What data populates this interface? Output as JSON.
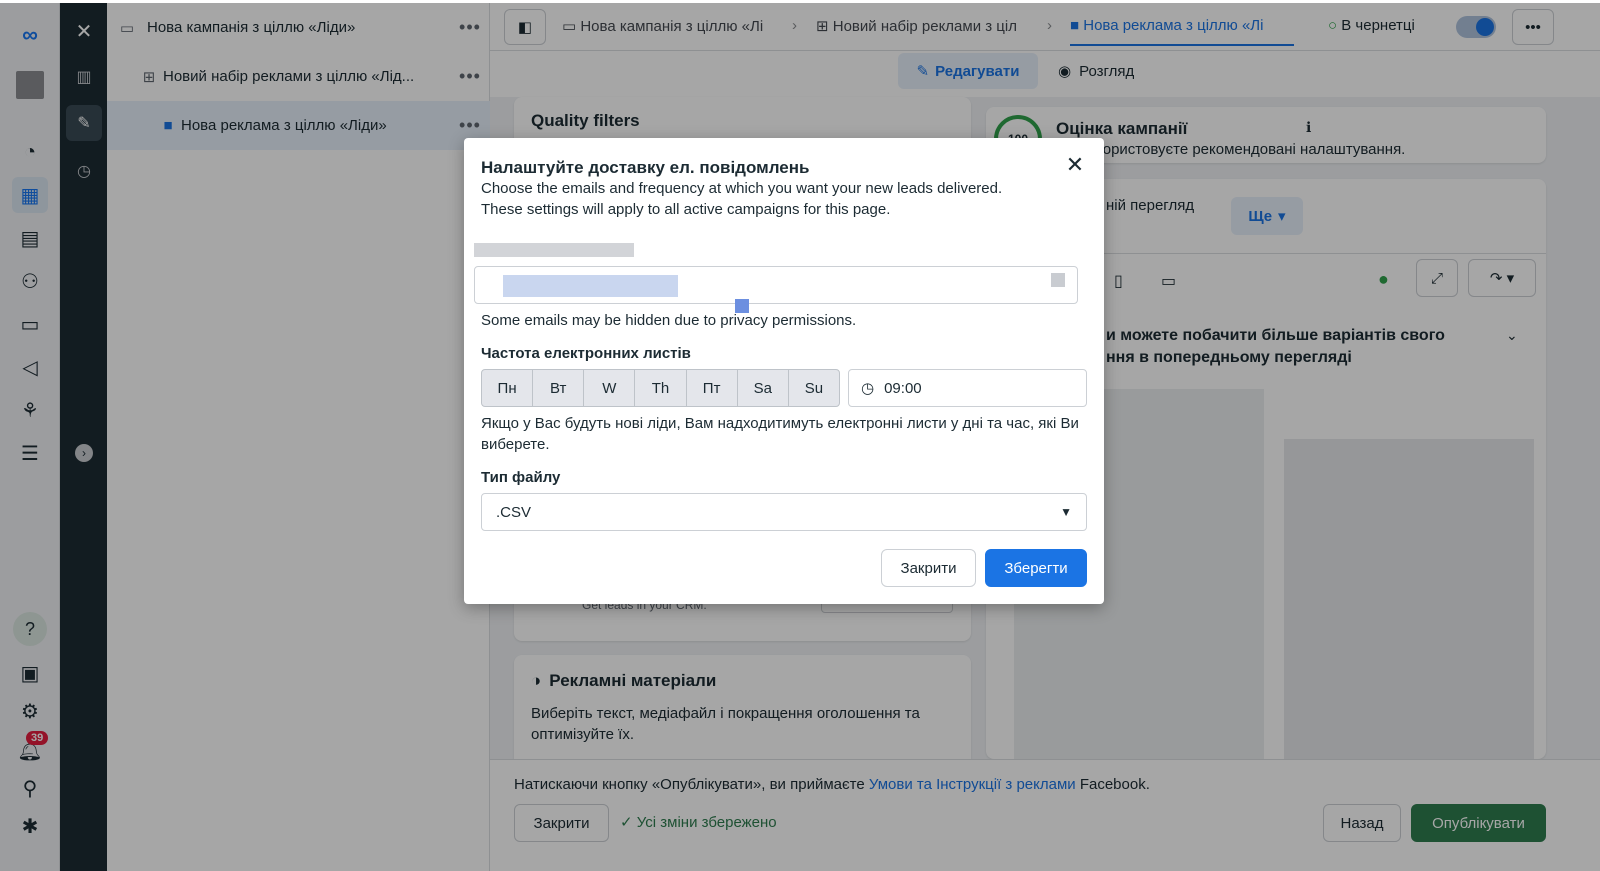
{
  "left_rail": {
    "notification_count": "39"
  },
  "tree": {
    "campaign": "Нова кампанія з ціллю «Ліди»",
    "adset": "Новий набір реклами з ціллю «Лід...",
    "ad": "Нова реклама з ціллю «Ліди»",
    "more": "•••"
  },
  "topbar": {
    "crumb_campaign": "Нова кампанія з ціллю «Лі",
    "crumb_adset": "Новий набір реклами з ціл",
    "crumb_ad": "Нова реклама з ціллю «Лі",
    "status": "В чернетці",
    "more": "•••"
  },
  "mode": {
    "edit_label": "Редагувати",
    "preview_label": "Розгляд"
  },
  "background": {
    "quality_filters": "Quality filters",
    "crm_text": "Get leads in your CRM.",
    "creatives_title": "Рекламні матеріали",
    "creatives_desc": "Виберіть текст, медіафайл і покращення оголошення та оптимізуйте їх.",
    "score_value": "100",
    "score_title": "Оцінка кампанії",
    "score_desc": "користовуєте рекомендовані налаштування.",
    "preview_text": "ній перегляд",
    "more_label": "Ще",
    "variants_text_1": "и можете побачити більше варіантів свого",
    "variants_text_2": "ння в попередньому перегляді"
  },
  "footer": {
    "terms_prefix": "Натискаючи кнопку «Опублікувати», ви приймаєте ",
    "terms_link": "Умови та Інструкції з реклами",
    "terms_suffix": " Facebook.",
    "close_label": "Закрити",
    "saved_status": "Усі зміни збережено",
    "back_label": "Назад",
    "publish_label": "Опублікувати"
  },
  "modal": {
    "title": "Налаштуйте доставку ел. повідомлень",
    "desc_line1": "Choose the emails and frequency at which you want your new leads delivered.",
    "desc_line2": "These settings will apply to all active campaigns for this page.",
    "privacy_note": "Some emails may be hidden due to privacy permissions.",
    "frequency_label": "Частота електронних листів",
    "days": [
      "Пн",
      "Вт",
      "W",
      "Th",
      "Пт",
      "Sa",
      "Su"
    ],
    "time_value": "09:00",
    "frequency_hint": "Якщо у Вас будуть нові ліди, Вам надходитимуть електронні листи у дні та час, які Ви виберете.",
    "file_type_label": "Тип файлу",
    "file_type_value": ".CSV",
    "close_label": "Закрити",
    "save_label": "Зберегти"
  },
  "colors": {
    "accent": "#1b74e4",
    "publish": "#2e7d4f",
    "link": "#1b74e4"
  }
}
